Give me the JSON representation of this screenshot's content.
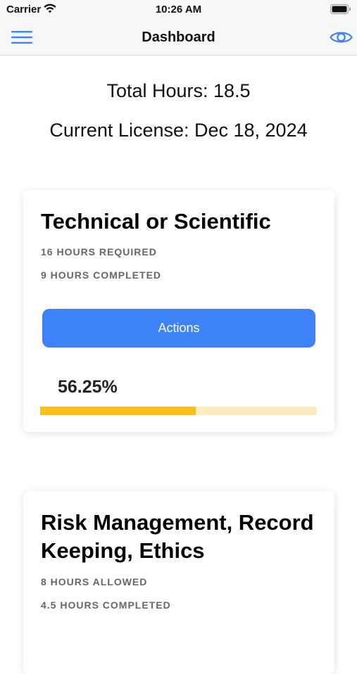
{
  "status_bar": {
    "carrier": "Carrier",
    "time": "10:26 AM",
    "wifi_icon": "wifi-icon",
    "battery_icon": "battery-icon"
  },
  "nav": {
    "title": "Dashboard",
    "menu_icon": "hamburger-menu-icon",
    "eye_icon": "eye-icon",
    "accent_color": "#3d82f7"
  },
  "summary": {
    "total_hours": "Total Hours: 18.5",
    "current_license": "Current License: Dec 18, 2024"
  },
  "cards": [
    {
      "title": "Technical or Scientific",
      "required": "16 HOURS REQUIRED",
      "completed": "9 HOURS COMPLETED",
      "action_label": "Actions",
      "progress_label": "56.25%",
      "progress_fraction": 0.5625,
      "progress_color": "#f8c01a",
      "progress_track_color": "#fdecc0"
    },
    {
      "title": "Risk Management, Record Keeping, Ethics",
      "allowed": "8 HOURS ALLOWED",
      "completed": "4.5 HOURS COMPLETED"
    }
  ]
}
